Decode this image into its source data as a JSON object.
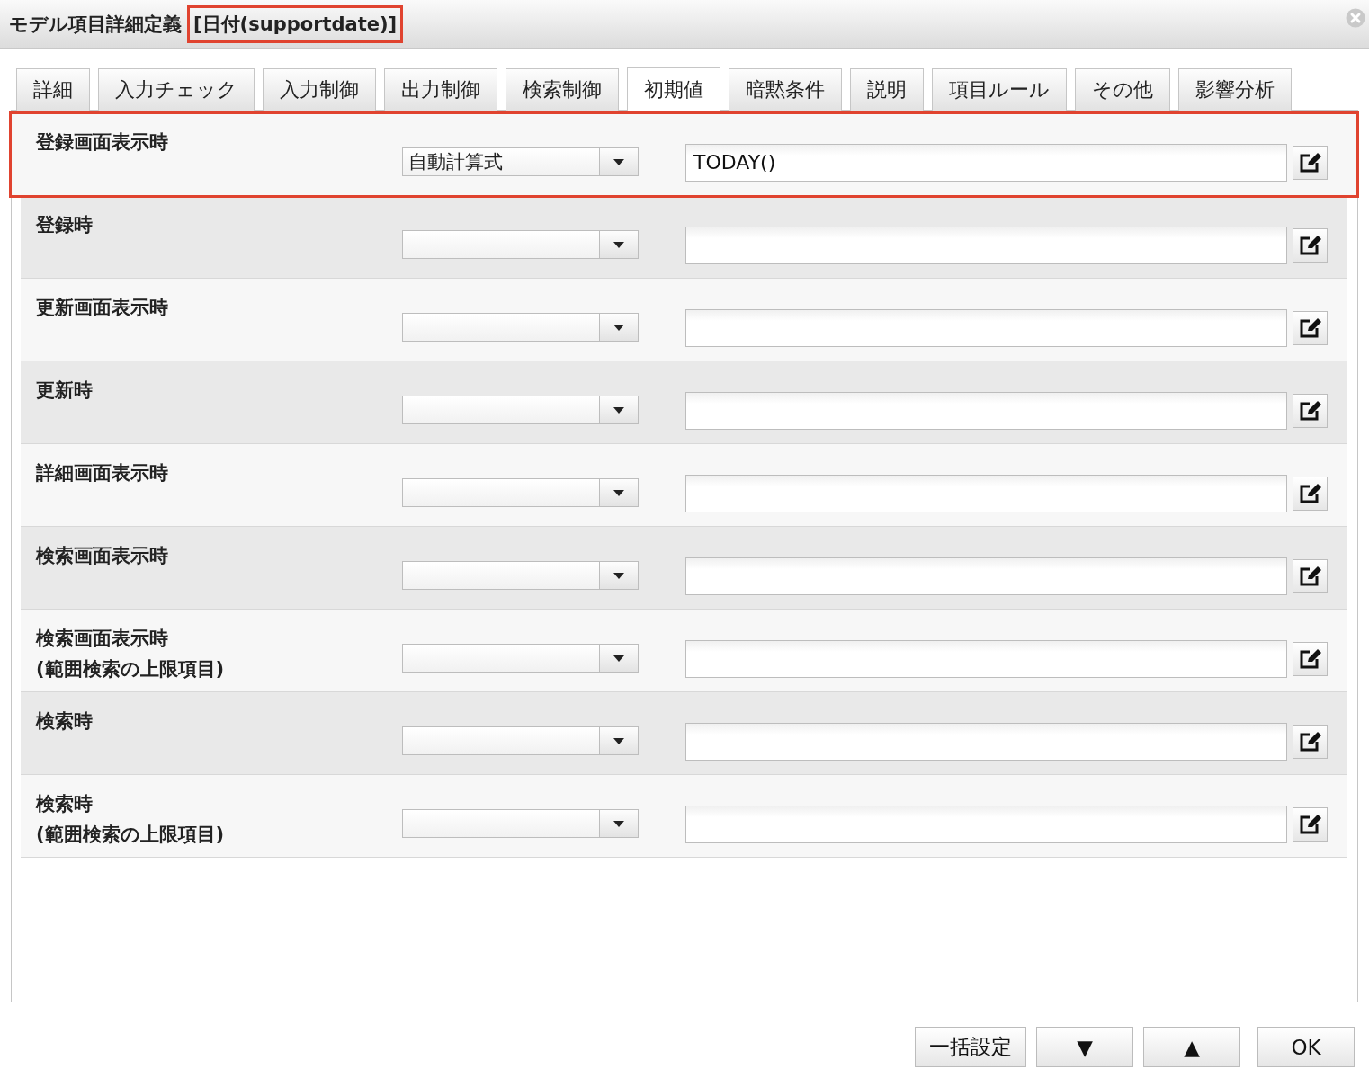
{
  "window": {
    "title": "モデル項目詳細定義",
    "subject": "[日付(supportdate)]",
    "subject_highlighted": true
  },
  "tabs": [
    {
      "label": "詳細",
      "selected": false
    },
    {
      "label": "入力チェック",
      "selected": false
    },
    {
      "label": "入力制御",
      "selected": false
    },
    {
      "label": "出力制御",
      "selected": false
    },
    {
      "label": "検索制御",
      "selected": false
    },
    {
      "label": "初期値",
      "selected": true
    },
    {
      "label": "暗黙条件",
      "selected": false
    },
    {
      "label": "説明",
      "selected": false
    },
    {
      "label": "項目ルール",
      "selected": false
    },
    {
      "label": "その他",
      "selected": false
    },
    {
      "label": "影響分析",
      "selected": false
    }
  ],
  "rows": [
    {
      "label": "登録画面表示時",
      "type": "自動計算式",
      "formula": "TODAY()",
      "highlighted": true
    },
    {
      "label": "登録時",
      "highlighted": false
    },
    {
      "label": "更新画面表示時",
      "highlighted": false
    },
    {
      "label": "更新時",
      "highlighted": false
    },
    {
      "label": "詳細画面表示時",
      "highlighted": false
    },
    {
      "label": "検索画面表示時",
      "highlighted": false
    },
    {
      "label": "検索画面表示時",
      "note": "(範囲検索の上限項目)",
      "highlighted": false
    },
    {
      "label": "検索時",
      "highlighted": false
    },
    {
      "label": "検索時",
      "note": "(範囲検索の上限項目)",
      "highlighted": false
    }
  ],
  "buttons": [
    "一括設定",
    "▼",
    "▲",
    "OK"
  ]
}
